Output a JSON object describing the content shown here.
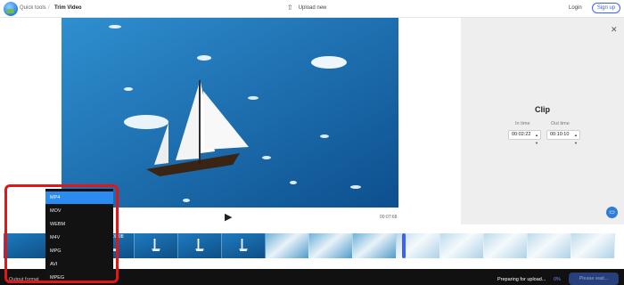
{
  "header": {
    "breadcrumb_root": "Quick tools",
    "breadcrumb_separator": "/",
    "breadcrumb_current": "Trim Video",
    "upload_label": "Upload new",
    "login_label": "Login",
    "signup_label": "Sign up"
  },
  "player": {
    "end_time": "00:07:68",
    "current_time": "00:08"
  },
  "clip_panel": {
    "title": "Clip",
    "in_label": "In time",
    "out_label": "Out time",
    "in_value": "00:02:22",
    "out_value": "00:10:10"
  },
  "format_dropdown": {
    "label": "Output format",
    "options": [
      "MP4",
      "MOV",
      "WEBM",
      "M4V",
      "MPG",
      "AVI",
      "MPEG"
    ],
    "selected": "MP4"
  },
  "status": {
    "preparing_text": "Preparing for upload...",
    "percent": "0%",
    "button_label": "Please wait..."
  },
  "colors": {
    "accent": "#3c62f5",
    "dropdown_selected": "#2a8cf0",
    "highlight": "#e21616"
  }
}
